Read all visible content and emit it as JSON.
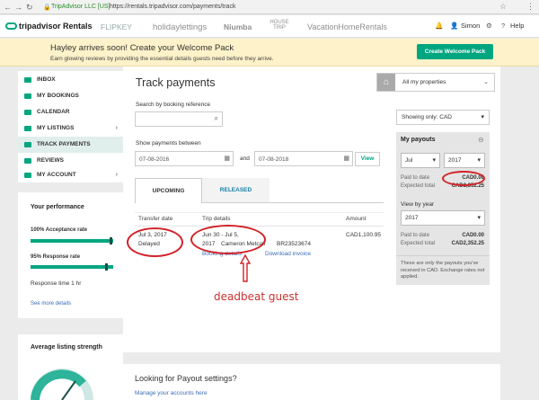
{
  "browser": {
    "secure_label": "TripAdvisor LLC [US]",
    "url": "https://rentals.tripadvisor.com/payments/track"
  },
  "header": {
    "logo_text": "tripadvisor Rentals",
    "brands": [
      "FLIPKEY",
      "holidaylettings",
      "Niumba",
      "HOUSE TRIP",
      "VacationHomeRentals"
    ],
    "user_name": "Simon",
    "help_label": "Help"
  },
  "banner": {
    "title": "Hayley arrives soon! Create your Welcome Pack",
    "subtitle": "Earn glowing reviews by providing the essential details guests need before they arrive.",
    "button_label": "Create Welcome Pack"
  },
  "sidebar": {
    "items": [
      {
        "label": "INBOX"
      },
      {
        "label": "MY BOOKINGS"
      },
      {
        "label": "CALENDAR"
      },
      {
        "label": "MY LISTINGS"
      },
      {
        "label": "TRACK PAYMENTS"
      },
      {
        "label": "REVIEWS"
      },
      {
        "label": "MY ACCOUNT"
      }
    ]
  },
  "performance": {
    "title": "Your performance",
    "acceptance_label": "100% Acceptance rate",
    "acceptance_value": 1.0,
    "response_label": "95% Response rate",
    "response_value": 0.95,
    "response_time": "Response time 1 hr",
    "more_link": "See more details"
  },
  "strength": {
    "title": "Average listing strength"
  },
  "main": {
    "title": "Track payments",
    "property_select": "All my properties",
    "search_label": "Search by booking reference",
    "between_label": "Show payments between",
    "date_from": "07-08-2016",
    "and_label": "and",
    "date_to": "07-08-2018",
    "view_button": "View",
    "tabs": [
      "UPCOMING",
      "RELEASED"
    ],
    "columns": [
      "Transfer date",
      "Trip details",
      "Amount"
    ],
    "row": {
      "transfer_date": "Jul 3, 2017",
      "status": "Delayed",
      "trip_dates_1": "Jun 30 - Jul 5,",
      "trip_dates_2": "2017",
      "guest": "Cameron Metcalf",
      "booking_ref": "BR23523674",
      "amount": "CAD1,100.95",
      "booking_details": "Booking details",
      "download_invoice": "Download invoice"
    }
  },
  "payouts": {
    "showing_label": "Showing only: CAD",
    "title": "My payouts",
    "month": "Jul",
    "year": "2017",
    "paid_label": "Paid to date",
    "paid_value": "CAD0.00",
    "expected_label": "Expected total",
    "expected_value": "CAD2,352.25",
    "view_by_year": "View by year",
    "year_select": "2017",
    "year_paid_value": "CAD0.00",
    "year_expected_value": "CAD2,352.25",
    "note": "These are only the payouts you've received in CAD. Exchange rates not applied."
  },
  "bottom": {
    "title": "Looking for Payout settings?",
    "link": "Manage your accounts here"
  },
  "annotation": {
    "text": "deadbeat guest"
  },
  "colors": {
    "brand_green": "#00a680",
    "banner_bg": "#fdf2c9",
    "annotation_red": "#d2232a"
  }
}
